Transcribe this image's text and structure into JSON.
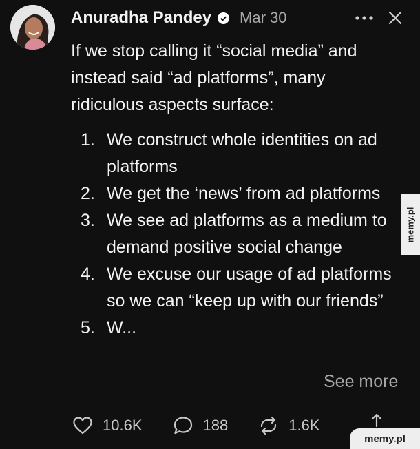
{
  "post": {
    "author_name": "Anuradha Pandey",
    "date": "Mar 30",
    "intro": "If we stop calling it “social media” and instead said “ad platforms”, many ridiculous aspects surface:",
    "list": [
      {
        "num": "1.",
        "text": "We construct whole identities on ad platforms"
      },
      {
        "num": "2.",
        "text": "We get the ‘news’ from ad platforms"
      },
      {
        "num": "3.",
        "text": "We see ad platforms as a medium to demand positive social change"
      },
      {
        "num": "4.",
        "text": "We excuse our usage of ad platforms so we can “keep up with our friends”"
      },
      {
        "num": "5.",
        "text": "W..."
      }
    ],
    "see_more": "See more"
  },
  "actions": {
    "likes": "10.6K",
    "replies": "188",
    "reposts": "1.6K"
  },
  "watermark": {
    "side": "memy.pl",
    "bottom": "memy.pl"
  },
  "icons": {
    "more": "more-icon",
    "close": "close-icon",
    "like": "heart-icon",
    "reply": "speech-bubble-icon",
    "repost": "repost-icon",
    "share": "share-icon",
    "verified": "verified-badge-icon"
  },
  "colors": {
    "background": "#101010",
    "text": "#f3f3f3",
    "muted": "#a8a8a8"
  }
}
